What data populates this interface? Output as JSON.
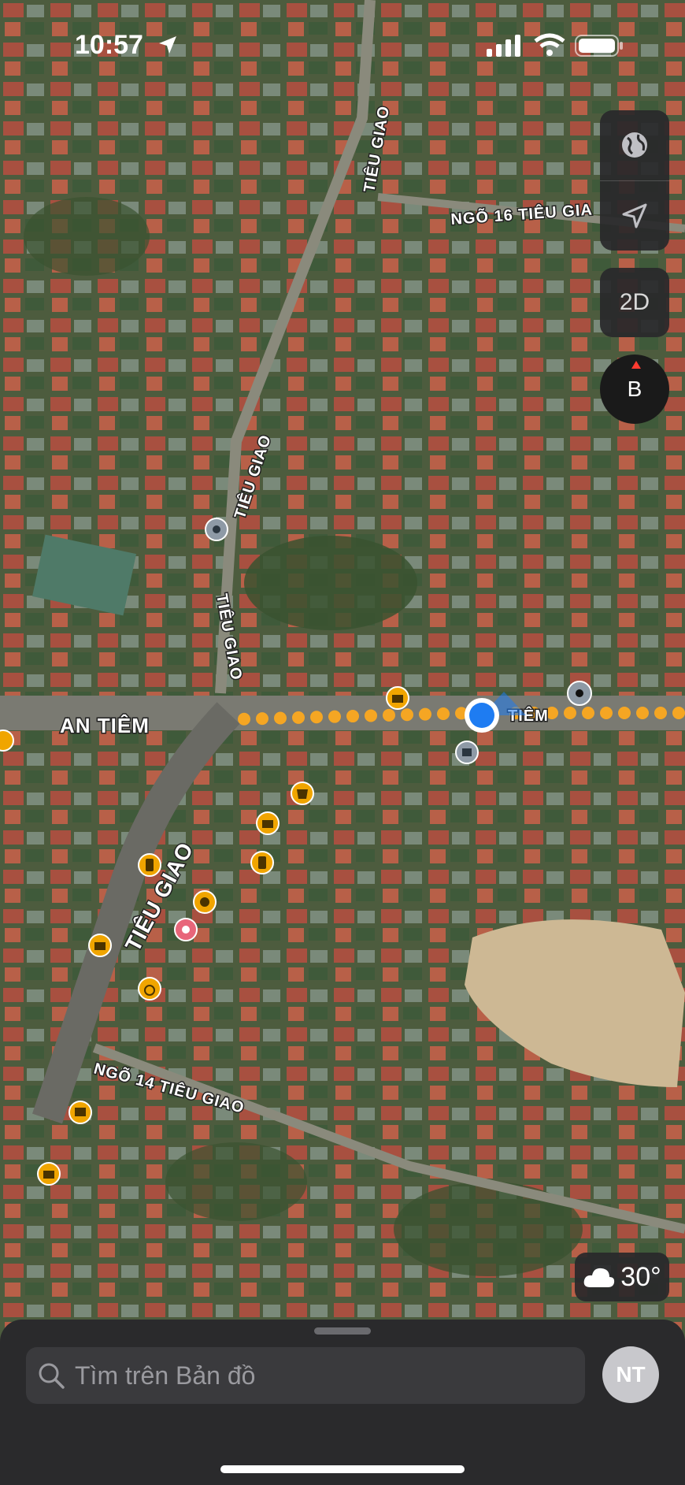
{
  "status_bar": {
    "time": "10:57"
  },
  "map_labels": {
    "tieu_giao_top": "TIÊU GIAO",
    "ngo_16": "NGÕ 16 TIÊU GIA",
    "tieu_giao_mid": "TIÊU GIAO",
    "tieu_giao_mid2": "TIÊU GIAO",
    "an_tiem": "AN TIÊM",
    "tiem_right": "TIÊM",
    "tieu_giao_bottom": "TIÊU GIAO",
    "ngo_14": "NGÕ 14 TIÊU GIAO"
  },
  "controls": {
    "mode_2d": "2D",
    "compass_letter": "B"
  },
  "weather": {
    "temperature": "30°"
  },
  "search": {
    "placeholder": "Tìm trên Bản đồ"
  },
  "avatar": {
    "initials": "NT"
  },
  "colors": {
    "route": "#f5a623",
    "user_location": "#1e7cf2",
    "poi": "#f0a500"
  }
}
